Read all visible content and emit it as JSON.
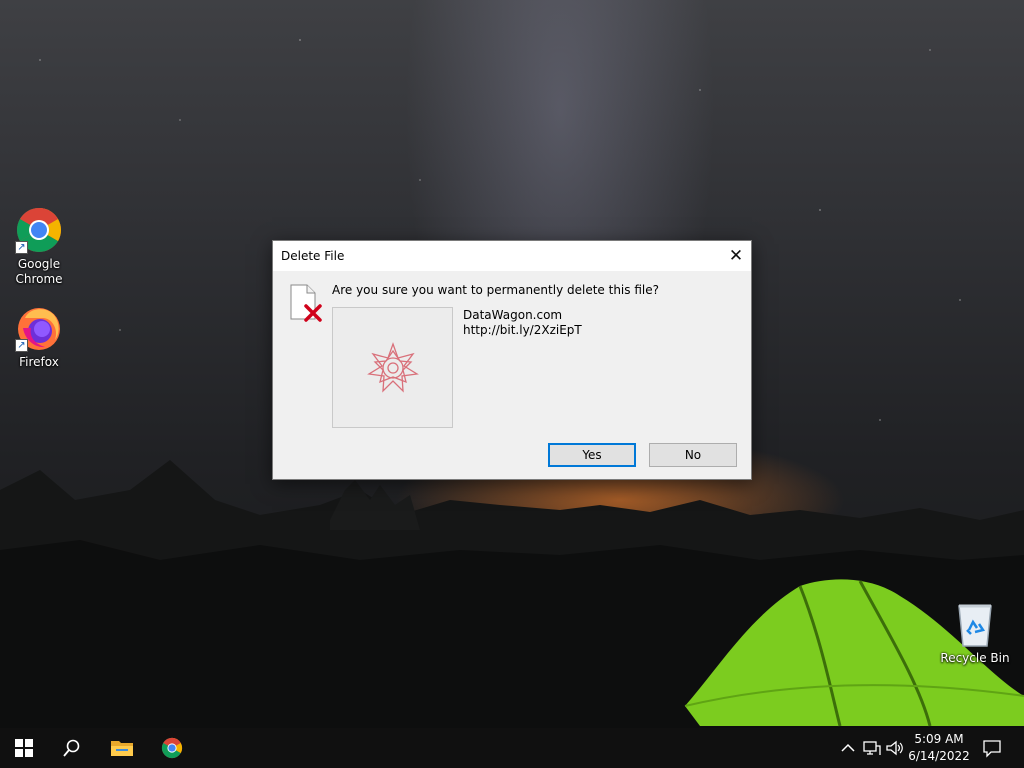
{
  "desktop": {
    "icons": [
      {
        "label": "Google Chrome"
      },
      {
        "label": "Firefox"
      },
      {
        "label": "Recycle Bin"
      }
    ]
  },
  "dialog": {
    "title": "Delete File",
    "question": "Are you sure you want to permanently delete this file?",
    "file_name": "DataWagon.com",
    "file_url": "http://bit.ly/2XziEpT",
    "yes_label": "Yes",
    "no_label": "No",
    "close_glyph": "✕"
  },
  "taskbar": {
    "time": "5:09 AM",
    "date": "6/14/2022",
    "pinned": [
      "start-icon",
      "search-icon",
      "file-explorer-icon",
      "chrome-icon"
    ],
    "tray": [
      "chevron-up-icon",
      "network-icon",
      "volume-icon",
      "notification-icon"
    ]
  },
  "colors": {
    "accent": "#0078d7",
    "delete_x": "#d0021b",
    "taskbar": "#101010"
  }
}
